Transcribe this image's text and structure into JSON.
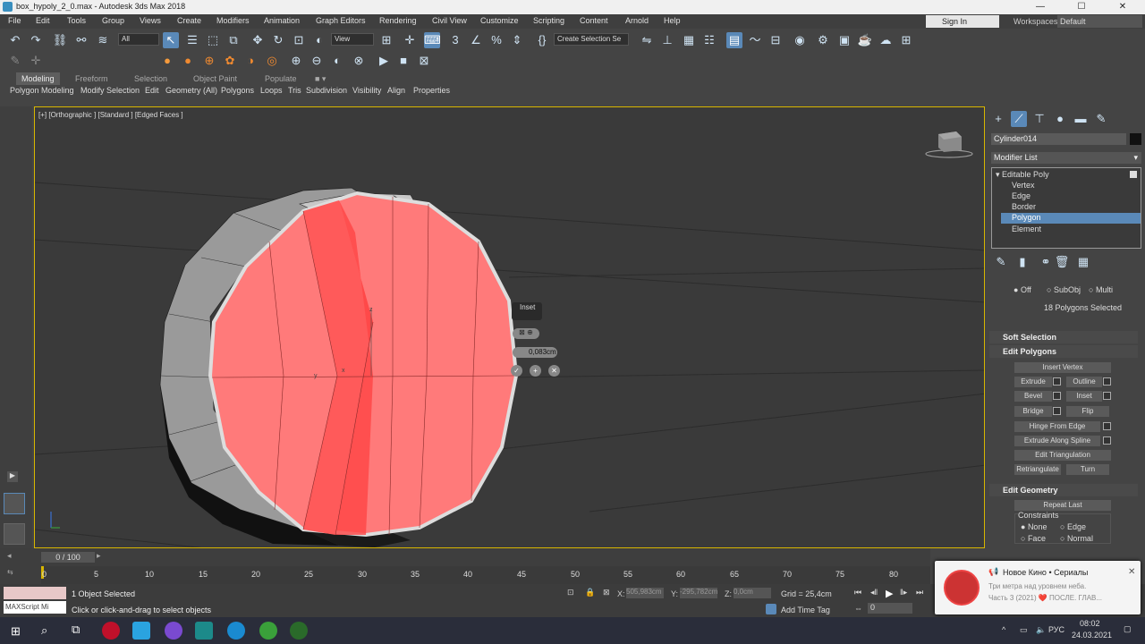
{
  "window": {
    "title": "box_hypoly_2_0.max - Autodesk 3ds Max 2018",
    "min": "—",
    "max": "☐",
    "close": "✕"
  },
  "menu": [
    "File",
    "Edit",
    "Tools",
    "Group",
    "Views",
    "Create",
    "Modifiers",
    "Animation",
    "Graph Editors",
    "Rendering",
    "Civil View",
    "Customize",
    "Scripting",
    "Content",
    "Arnold",
    "Help"
  ],
  "signin": "Sign In",
  "workspaces": {
    "label": "Workspaces:",
    "value": "Default"
  },
  "toolbar": {
    "filter": "All",
    "refcoord": "View",
    "selection_set": "Create Selection Se"
  },
  "ribbon": {
    "tabs": [
      "Modeling",
      "Freeform",
      "Selection",
      "Object Paint",
      "Populate"
    ],
    "items": [
      "Polygon Modeling",
      "Modify Selection",
      "Edit",
      "Geometry (All)",
      "Polygons",
      "Loops",
      "Tris",
      "Subdivision",
      "Visibility",
      "Align",
      "Properties"
    ]
  },
  "viewport": {
    "label": "[+] [Orthographic ] [Standard ] [Edged Faces ]",
    "caddy_title": "Inset",
    "caddy_value": "0,083cm"
  },
  "command_panel": {
    "object_name": "Cylinder014",
    "modifier_list": "Modifier List",
    "stack": [
      "Editable Poly",
      "Vertex",
      "Edge",
      "Border",
      "Polygon",
      "Element"
    ],
    "stack_selected": "Polygon",
    "preview": {
      "off": "Off",
      "subobj": "SubObj",
      "multi": "Multi"
    },
    "selected_count": "18 Polygons Selected",
    "rollouts": {
      "soft": "Soft Selection",
      "edit_polys": "Edit Polygons",
      "edit_geom": "Edit Geometry"
    },
    "insert_vertex": "Insert Vertex",
    "buttons": [
      [
        "Extrude",
        "Outline"
      ],
      [
        "Bevel",
        "Inset"
      ],
      [
        "Bridge",
        "Flip"
      ]
    ],
    "hinge": "Hinge From Edge",
    "extrude_spline": "Extrude Along Spline",
    "edit_tri": "Edit Triangulation",
    "retriangulate": "Retriangulate",
    "turn": "Turn",
    "repeat_last": "Repeat Last",
    "constraints": {
      "label": "Constraints",
      "none": "None",
      "edge": "Edge",
      "face": "Face",
      "normal": "Normal"
    }
  },
  "timeline": {
    "frame": "0 / 100",
    "ticks": [
      "0",
      "5",
      "10",
      "15",
      "20",
      "25",
      "30",
      "35",
      "40",
      "45",
      "50",
      "55",
      "60",
      "65",
      "70",
      "75",
      "80"
    ]
  },
  "status": {
    "objects": "1 Object Selected",
    "prompt": "Click or click-and-drag to select objects",
    "maxscript": "MAXScript Mi",
    "x": "505,983cm",
    "y": "-295,782cm",
    "z": "0,0cm",
    "grid": "Grid = 25,4cm",
    "add_time_tag": "Add Time Tag",
    "frame_field": "0"
  },
  "notification": {
    "title": "Новое Кино • Сериалы",
    "line1": "Три метра над уровнем неба.",
    "line2": "Часть 3 (2021) ❤️ ПОСЛЕ. ГЛАВ..."
  },
  "taskbar": {
    "lang": "РУС",
    "time": "08:02",
    "date": "24.03.2021"
  },
  "colors": {
    "selected_poly": "#ff7a7a",
    "dark_poly": "#ff5050",
    "accent": "#5a89b8",
    "viewport_border": "#d8b600"
  }
}
